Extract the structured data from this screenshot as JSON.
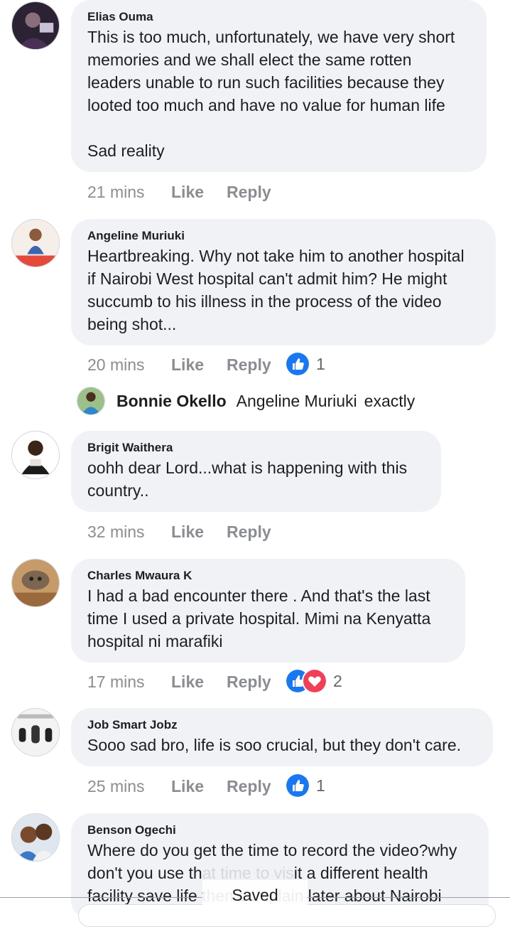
{
  "comments": [
    {
      "author": "Elias Ouma",
      "text": "This is too much, unfortunately, we have very short\nmemories and we shall elect the same rotten\nleaders unable to run such facilities because they\nlooted too much and have no value for human life\n\nSad reality",
      "time": "21 mins",
      "like": "Like",
      "reply": "Reply"
    },
    {
      "author": "Angeline Muriuki",
      "text": "Heartbreaking. Why not take him to another hospital\nif Nairobi West hospital can't admit him? He might\nsuccumb to his illness in the process of the video\nbeing shot...",
      "time": "20 mins",
      "like": "Like",
      "reply": "Reply",
      "reaction_count": "1"
    },
    {
      "author": "Brigit Waithera",
      "text": "oohh dear Lord...what is happening  with this\ncountry..",
      "time": "32 mins",
      "like": "Like",
      "reply": "Reply"
    },
    {
      "author": "Charles Mwaura K",
      "text": "I had a bad encounter there .  And that's the last\ntime I used a private hospital. Mimi na Kenyatta\nhospital ni marafiki",
      "time": "17 mins",
      "like": "Like",
      "reply": "Reply",
      "reaction_count": "2"
    },
    {
      "author": "Job Smart Jobz",
      "text": "Sooo sad bro, life is soo crucial, but they don't care.",
      "time": "25 mins",
      "like": "Like",
      "reply": "Reply",
      "reaction_count": "1"
    },
    {
      "author": "Benson Ogechi",
      "text_line1": "Where do you get the time to record the video?why",
      "text_line2_a": "don't you use th",
      "text_line2_b": "at time to vis",
      "text_line2_c": "it a different health",
      "text_line3_a": "facility save life",
      "text_line3_b": "then complain later about Nairobi"
    }
  ],
  "inline_reply": {
    "author": "Bonnie Okello",
    "mention": "Angeline Muriuki",
    "text": "exactly"
  },
  "toast": {
    "label": "Saved"
  },
  "colors": {
    "bubble": "#f0f2f5",
    "meta_text": "#8a8d91",
    "like_blue": "#1877f2",
    "love_red": "#f33e58"
  },
  "icons": {
    "like_reaction": "like-reaction-icon",
    "love_reaction": "love-reaction-icon"
  }
}
